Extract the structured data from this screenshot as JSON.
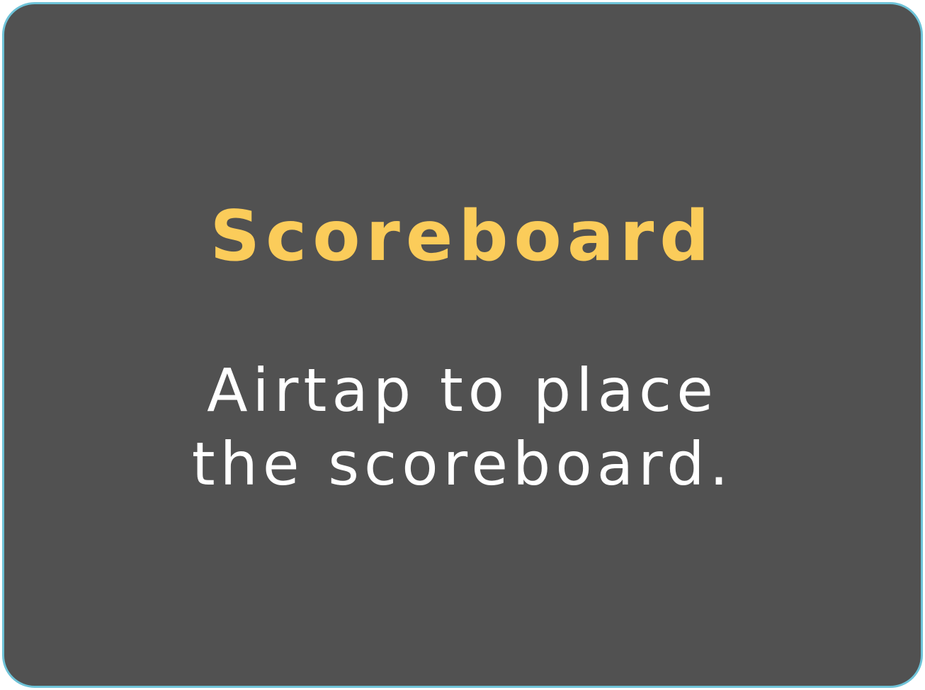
{
  "panel": {
    "title": "Scoreboard",
    "message_lines": [
      "Airtap to place",
      "the scoreboard."
    ]
  },
  "colors": {
    "panel_background": "#515151",
    "panel_border": "#6ec3d8",
    "title": "#fbcc5a",
    "message": "#ffffff"
  }
}
